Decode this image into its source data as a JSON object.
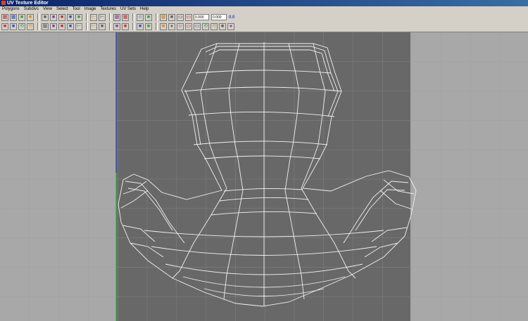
{
  "window": {
    "title": "UV Texture Editor"
  },
  "menu": [
    "Polygons",
    "Subdivs",
    "View",
    "Select",
    "Tool",
    "Image",
    "Textures",
    "UV Sets",
    "Help"
  ],
  "toolbar": {
    "u_value": "0.000",
    "v_value": "0.000",
    "zero_label": "0.0",
    "row1_icons": [
      "checker-icon",
      "grid-select-icon",
      "cut-arrow-icon",
      "move-uv-icon",
      "flip-u-icon",
      "flip-v-icon",
      "cube-icon",
      "layout-icon",
      "sew-icon",
      "align-left-icon",
      "align-right-icon",
      "grid-view-icon",
      "grid-view2-icon",
      "avatar-icon",
      "diagonal-icon",
      "grid-toggle-icon",
      "texture-icon",
      "copy-uv-icon",
      "paste-uv-icon"
    ],
    "row2_icons": [
      "pin-icon",
      "snapshot-icon",
      "rotate-ccw-icon",
      "rotate-cw-icon",
      "grid-small-icon",
      "palette-icon",
      "unfold-icon",
      "relax-icon",
      "align-bottom-icon",
      "align-top-icon",
      "isolate-icon",
      "isolate2-icon",
      "display-icon",
      "shaded-icon",
      "color-icon",
      "dim-icon",
      "red-circle-icon",
      "person-icon",
      "copy-icon",
      "paste-icon",
      "cycle-icon",
      "cycle2-icon",
      "shuffle-icon",
      "target-icon"
    ]
  },
  "colors": {
    "background": "#a8a8a8",
    "uv_range": "#686868",
    "grid_line": "#9a9a9a",
    "wire": "#f2f2f2",
    "u_axis": "#3040c0",
    "v_axis": "#30b040"
  }
}
